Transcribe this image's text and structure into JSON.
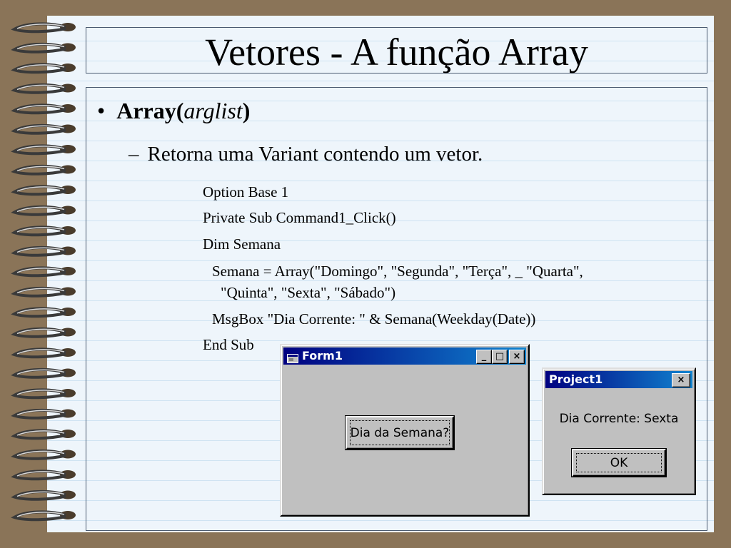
{
  "slide": {
    "title": "Vetores - A função Array",
    "bullet": {
      "lead": "Array(",
      "italic": "arglist",
      "tail": ")"
    },
    "sub_dash": "–",
    "sub_text": "Retorna uma Variant contendo um vetor.",
    "code_lines": [
      "Option Base 1",
      "Private Sub Command1_Click()",
      "Dim Semana",
      "Semana = Array(\"Domingo\", \"Segunda\", \"Terça\", _ \"Quarta\",",
      "\"Quinta\", \"Sexta\", \"Sábado\")",
      "MsgBox \"Dia Corrente: \" & Semana(Weekday(Date))",
      "End Sub"
    ]
  },
  "form1": {
    "title": "Form1",
    "button_label": "Dia da Semana?",
    "controls": {
      "minimize": "_",
      "maximize": "□",
      "close": "×"
    }
  },
  "msgbox": {
    "title": "Project1",
    "message": "Dia Corrente: Sexta",
    "ok_label": "OK",
    "close": "×"
  }
}
